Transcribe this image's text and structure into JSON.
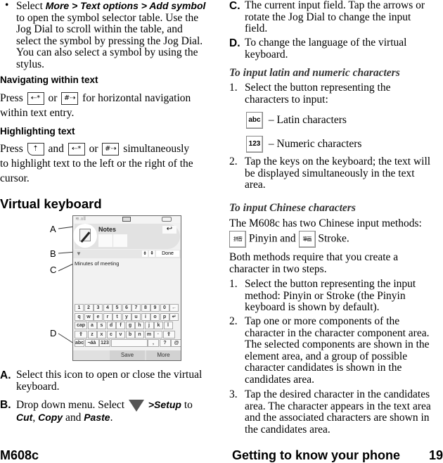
{
  "left": {
    "bullet_intro": {
      "bullet": "•",
      "select": "Select",
      "path": "More > Text options > Add symbol",
      "rest_lines": [
        "to open the symbol selector table. Use the",
        "Jog Dial to scroll within the table, and",
        "select the symbol by pressing the Jog Dial.",
        "You can also select a symbol by using the",
        "stylus."
      ]
    },
    "nav_heading": "Navigating within text",
    "nav_text": {
      "press": "Press",
      "or": "or",
      "after": "for horizontal navigation",
      "line2": "within text entry."
    },
    "highlight_heading": "Highlighting text",
    "highlight_text": {
      "press": "Press",
      "and": "and",
      "or": "or",
      "after": "simultaneously",
      "line2": "to highlight text to the left or the right of the",
      "line3": "cursor."
    },
    "section_heading": "Virtual keyboard",
    "keys": {
      "star_key": "⇠*",
      "hash_key": "#⇢",
      "shift_key": "⇡"
    },
    "callouts": [
      "A",
      "B",
      "C",
      "D"
    ],
    "phone": {
      "app_title": "Notes",
      "done_label": "Done",
      "input_text": "Minutes of meeting",
      "kb_rows": [
        [
          "1",
          "2",
          "3",
          "4",
          "5",
          "6",
          "7",
          "8",
          "9",
          "0",
          "←"
        ],
        [
          "q",
          "w",
          "e",
          "r",
          "t",
          "y",
          "u",
          "i",
          "o",
          "p",
          "↵"
        ],
        [
          "cap",
          "a",
          "s",
          "d",
          "f",
          "g",
          "h",
          "j",
          "k",
          "l"
        ],
        [
          "⇧",
          "z",
          "x",
          "c",
          "v",
          "b",
          "n",
          "m",
          "·",
          "⇧"
        ],
        [
          "abc",
          "¬áà",
          "123",
          "",
          ",",
          "?",
          "@"
        ]
      ],
      "save_label": "Save",
      "more_label": "More"
    },
    "items": [
      {
        "label": "A.",
        "lines": [
          "Select this icon to open or close the virtual",
          "keyboard."
        ]
      },
      {
        "label": "B.",
        "pre": "Drop down menu. Select",
        "setup": ">Setup",
        "to": "to",
        "cut": "Cut",
        "comma": ",",
        "copy": "Copy",
        "and": "and",
        "paste": "Paste",
        "period": "."
      }
    ]
  },
  "right": {
    "items": [
      {
        "label": "C.",
        "lines": [
          "The current input field. Tap the arrows or",
          "rotate the Jog Dial to change the input",
          "field."
        ]
      },
      {
        "label": "D.",
        "lines": [
          "To change the language of the virtual",
          "keyboard."
        ]
      }
    ],
    "latin_heading": "To input latin and numeric characters",
    "latin_steps": [
      {
        "num": "1.",
        "lines": [
          "Select the button representing the",
          "characters to input:"
        ]
      },
      {
        "num": "2.",
        "lines": [
          "Tap the keys on the keyboard; the text will",
          "be displayed simultaneously in the text",
          "area."
        ]
      }
    ],
    "buttons": [
      {
        "icon": "abc",
        "text": "– Latin characters"
      },
      {
        "icon": "123",
        "text": "– Numeric characters"
      }
    ],
    "chinese_heading": "To input Chinese characters",
    "chinese_intro": "The M608c has two Chinese input methods:",
    "pinyin_icon": "拼音",
    "pinyin_text": "Pinyin and",
    "stroke_icon": "筆画",
    "stroke_text": "Stroke.",
    "both_lines": [
      "Both methods require that you create a",
      "character in two steps."
    ],
    "chinese_steps": [
      {
        "num": "1.",
        "lines": [
          "Select the button representing the input",
          "method: Pinyin or Stroke (the Pinyin",
          "keyboard is shown by default)."
        ]
      },
      {
        "num": "2.",
        "lines": [
          "Tap one or more components of the",
          "character in the character component area.",
          "The selected components are shown in the",
          "element area, and a group of possible",
          "character candidates is shown in the",
          "candidates area."
        ]
      },
      {
        "num": "3.",
        "lines": [
          "Tap the desired character in the candidates",
          "area. The character appears in the text area",
          "and the associated characters are shown in",
          "the candidates area."
        ]
      }
    ]
  },
  "footer": {
    "model": "M608c",
    "section": "Getting to know your phone",
    "page": "19"
  }
}
